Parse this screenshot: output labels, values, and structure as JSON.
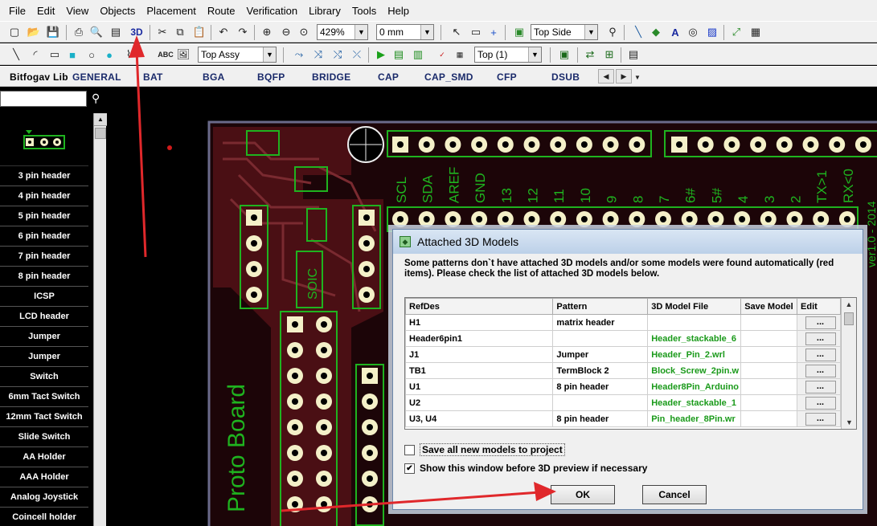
{
  "menu": [
    "File",
    "Edit",
    "View",
    "Objects",
    "Placement",
    "Route",
    "Verification",
    "Library",
    "Tools",
    "Help"
  ],
  "toolbar1": {
    "three_d_label": "3D",
    "zoom_value": "429%",
    "grid_value": "0 mm",
    "side_value": "Top Side"
  },
  "toolbar2": {
    "text_tool_label": "ABC",
    "layer_value": "Top Assy",
    "top_layer_value": "Top (1)"
  },
  "library_bar": {
    "items": [
      "Bitfogav Lib",
      "GENERAL",
      "BAT",
      "BGA",
      "BQFP",
      "BRIDGE",
      "CAP",
      "CAP_SMD",
      "CFP",
      "DSUB"
    ]
  },
  "sidebar": {
    "parts": [
      "3 pin header",
      "4 pin header",
      "5 pin header",
      "6 pin header",
      "7 pin header",
      "8 pin header",
      "ICSP",
      "LCD header",
      "Jumper",
      "Jumper",
      "Switch",
      "6mm Tact Switch",
      "12mm Tact Switch",
      "Slide Switch",
      "AA Holder",
      "AAA Holder",
      "Analog Joystick",
      "Coincell holder"
    ]
  },
  "board": {
    "pin_labels": [
      "SCL",
      "SDA",
      "AREF",
      "GND",
      "13",
      "12",
      "11",
      "10",
      "9",
      "8",
      "7",
      "6#",
      "5#",
      "4",
      "3",
      "2",
      "TX>1",
      "RX<0"
    ],
    "proto_label": "Proto Board",
    "soic_label": "SOIC",
    "version_label": "ver1.0 - 2014"
  },
  "dialog": {
    "title": "Attached 3D Models",
    "message": "Some patterns don`t have attached 3D models and/or some models were found automatically (red items). Please check the list of attached 3D models below.",
    "columns": [
      "RefDes",
      "Pattern",
      "3D Model File",
      "Save Model",
      "Edit"
    ],
    "rows": [
      {
        "refdes": "H1",
        "pattern": "matrix header",
        "model": "",
        "edit": "..."
      },
      {
        "refdes": "Header6pin1",
        "pattern": "",
        "model": "Header_stackable_6",
        "edit": "..."
      },
      {
        "refdes": "J1",
        "pattern": "Jumper",
        "model": "Header_Pin_2.wrl",
        "edit": "..."
      },
      {
        "refdes": "TB1",
        "pattern": "TermBlock 2",
        "model": "Block_Screw_2pin.w",
        "edit": "..."
      },
      {
        "refdes": "U1",
        "pattern": "8 pin header",
        "model": "Header8Pin_Arduino",
        "edit": "..."
      },
      {
        "refdes": "U2",
        "pattern": "",
        "model": "Header_stackable_1",
        "edit": "..."
      },
      {
        "refdes": "U3, U4",
        "pattern": "8 pin header",
        "model": "Pin_header_8Pin.wr",
        "edit": "..."
      }
    ],
    "save_all_label": "Save all new models to project",
    "show_window_label": "Show this window before 3D preview if necessary",
    "save_all_checked": false,
    "show_window_checked": true,
    "ok_label": "OK",
    "cancel_label": "Cancel"
  },
  "colors": {
    "pcb_copper": "#4a0f14",
    "pcb_silk": "#1fb31f",
    "pad_fill": "#f4f0c8",
    "annotation_arrow": "#e0282b"
  }
}
